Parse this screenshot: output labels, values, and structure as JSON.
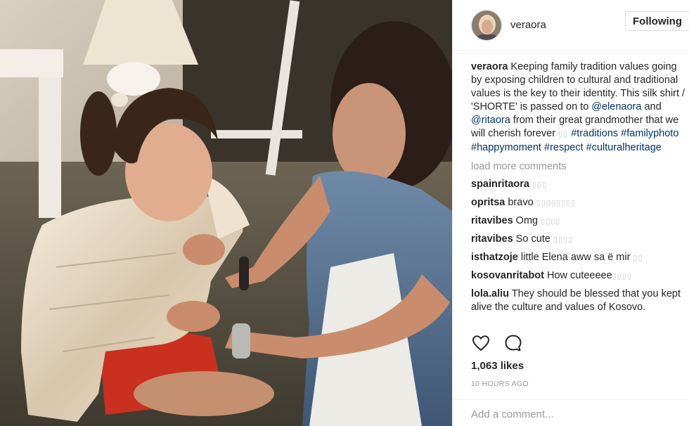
{
  "header": {
    "username": "veraora",
    "follow_label": "Following"
  },
  "caption": {
    "author": "veraora",
    "text_1": " Keeping family tradition values going by exposing children to cultural and traditional values is the key to their identity. This silk shirt / 'SHORTE' is passed on to ",
    "mention_1": "@elenaora",
    "text_2": " and ",
    "mention_2": "@ritaora",
    "text_3": " from their great grandmother that we will cherish forever ",
    "glyphs": "▯▯",
    "hashtags": [
      "#traditions",
      "#familyphoto",
      "#happymoment",
      "#respect",
      "#culturalheritage"
    ]
  },
  "load_more_label": "load more comments",
  "comments": [
    {
      "user": "spainritaora",
      "text": "",
      "glyphs": "▯▯▯"
    },
    {
      "user": "opritsa",
      "text": " bravo",
      "glyphs": "▯▯▯▯▯▯▯▯"
    },
    {
      "user": "ritavibes",
      "text": " Omg",
      "glyphs": "▯▯▯▯"
    },
    {
      "user": "ritavibes",
      "text": " So cute",
      "glyphs": "▯▯▯▯"
    },
    {
      "user": "isthatzoje",
      "text": " little Elena aww sa ë mir",
      "glyphs": "▯▯"
    },
    {
      "user": "kosovanritabot",
      "text": " How cuteeeee",
      "glyphs": "▯▯▯▯"
    },
    {
      "user": "lola.aliu",
      "text": " They should be blessed that you kept alive the culture and values of Kosovo.",
      "glyphs": ""
    }
  ],
  "actions": {
    "like_icon": "heart-icon",
    "comment_icon": "speech-bubble-icon"
  },
  "likes_label": "1,063 likes",
  "timestamp": "10 HOURS AGO",
  "comment_placeholder": "Add a comment...",
  "colors": {
    "link": "#003569",
    "muted": "#999999",
    "border": "#efefef"
  }
}
